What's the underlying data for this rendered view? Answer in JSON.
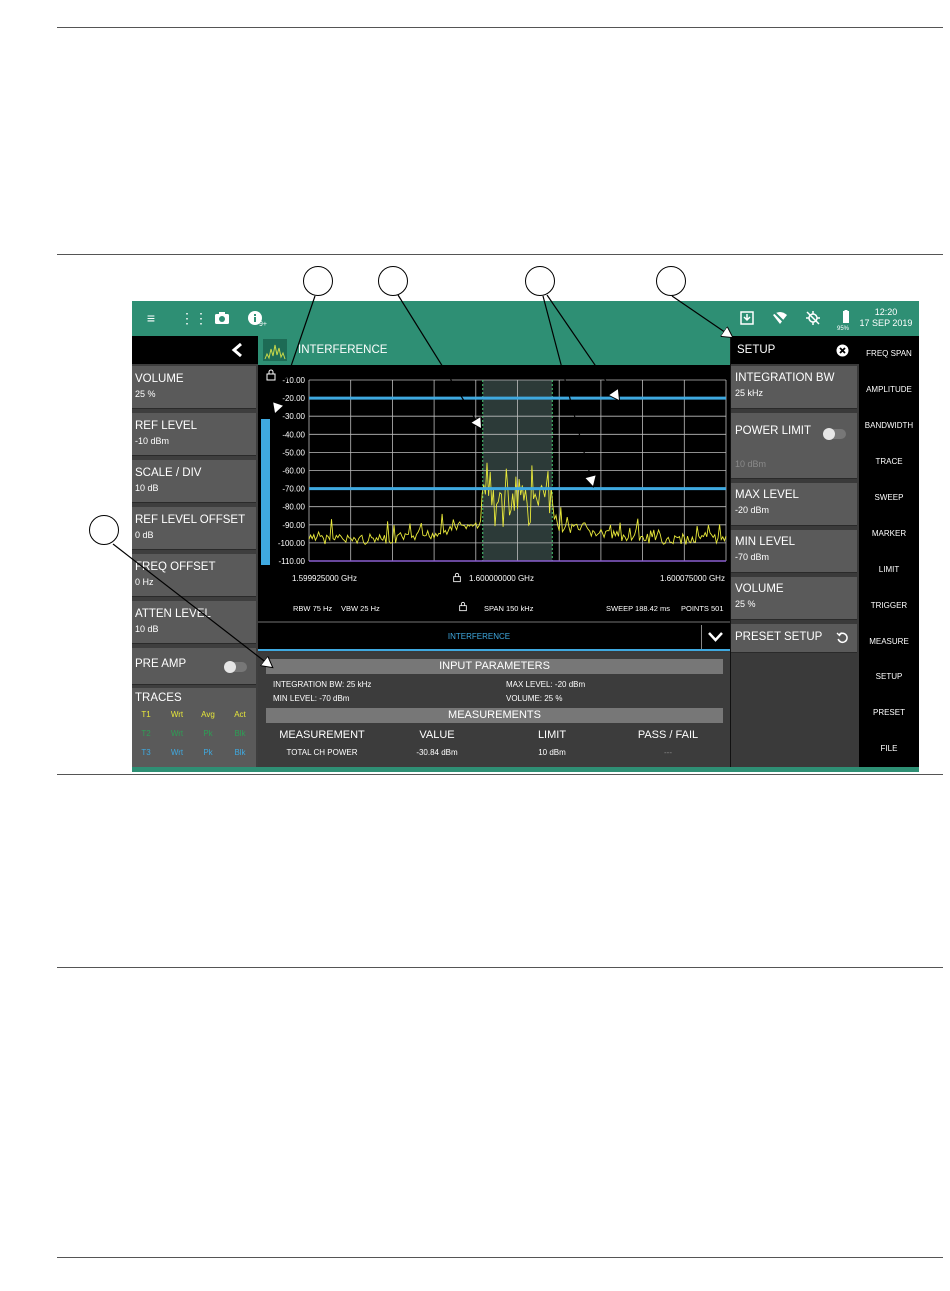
{
  "status_bar": {
    "clock_time": "12:20",
    "clock_date": "17 SEP 2019",
    "battery": "95%",
    "info_badge": "9+",
    "icons": [
      "menu-icon",
      "apps-grid-icon",
      "camera-icon",
      "info-icon",
      "download-icon",
      "wifi-off-icon",
      "gps-off-icon",
      "battery-icon"
    ]
  },
  "left_panel": {
    "items": [
      {
        "label": "VOLUME",
        "value": "25 %"
      },
      {
        "label": "REF LEVEL",
        "value": "-10 dBm"
      },
      {
        "label": "SCALE / DIV",
        "value": "10 dB"
      },
      {
        "label": "REF LEVEL OFFSET",
        "value": "0 dB"
      },
      {
        "label": "FREQ OFFSET",
        "value": "0 Hz"
      },
      {
        "label": "ATTEN LEVEL",
        "value": "10 dB"
      }
    ],
    "pre_amp_label": "PRE AMP",
    "traces_label": "TRACES",
    "traces": [
      [
        "T1",
        "Wrt",
        "Avg",
        "Act"
      ],
      [
        "T2",
        "Wrt",
        "Pk",
        "Blk"
      ],
      [
        "T3",
        "Wrt",
        "Pk",
        "Blk"
      ]
    ]
  },
  "main": {
    "title": "INTERFERENCE",
    "sub_title": "INTERFERENCE",
    "freq_left": "1.599925000 GHz",
    "freq_center": "1.600000000 GHz",
    "freq_right": "1.600075000 GHz",
    "rbw": "RBW 75 Hz",
    "vbw": "VBW 25 Hz",
    "span": "SPAN 150 kHz",
    "sweep": "SWEEP   188.42 ms",
    "points": "POINTS 501"
  },
  "chart_data": {
    "type": "line",
    "ylim": [
      -110,
      -10
    ],
    "y_tick_labels": [
      "-10.00",
      "-20.00",
      "-30.00",
      "-40.00",
      "-50.00",
      "-60.00",
      "-70.00",
      "-80.00",
      "-90.00",
      "-100.00",
      "-110.00"
    ],
    "x_range_ghz": [
      1.599925,
      1.600075
    ],
    "integration_bw_khz": 25,
    "max_level_dbm": -20,
    "min_level_dbm": -70,
    "noise_floor_dbm": -95,
    "signal_peak_dbm": -55,
    "grid": true
  },
  "results": {
    "input_header": "INPUT PARAMETERS",
    "integration_bw": "INTEGRATION BW: 25 kHz",
    "min_level": "MIN LEVEL: -70 dBm",
    "max_level": "MAX LEVEL: -20 dBm",
    "volume": "VOLUME: 25 %",
    "meas_header": "MEASUREMENTS",
    "columns": [
      "MEASUREMENT",
      "VALUE",
      "LIMIT",
      "PASS / FAIL"
    ],
    "row": [
      "TOTAL CH POWER",
      "-30.84 dBm",
      "10 dBm",
      "---"
    ]
  },
  "setup_panel": {
    "title": "SETUP",
    "integration_bw_label": "INTEGRATION BW",
    "integration_bw_value": "25 kHz",
    "power_limit_label": "POWER LIMIT",
    "power_limit_value": "10 dBm",
    "max_level_label": "MAX LEVEL",
    "max_level_value": "-20 dBm",
    "min_level_label": "MIN LEVEL",
    "min_level_value": "-70 dBm",
    "volume_label": "VOLUME",
    "volume_value": "25 %",
    "preset_label": "PRESET SETUP"
  },
  "right_menu": [
    "FREQ SPAN",
    "AMPLITUDE",
    "BANDWIDTH",
    "TRACE",
    "SWEEP",
    "MARKER",
    "LIMIT",
    "TRIGGER",
    "MEASURE",
    "SETUP",
    "PRESET",
    "FILE"
  ],
  "colors": {
    "accent": "#2e8f74",
    "trace": "#e8e83a",
    "level_line": "#3fa9e0",
    "text_muted": "#8a8a8a"
  }
}
